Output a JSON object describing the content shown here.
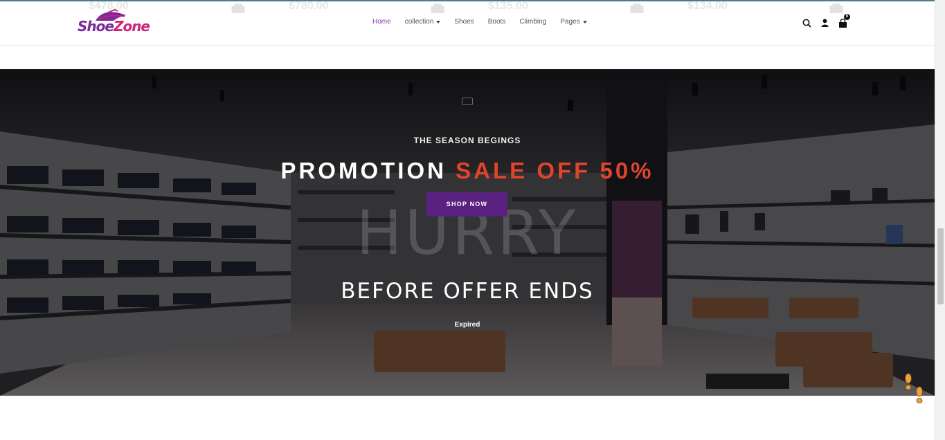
{
  "peek_prices": [
    "$478.00",
    "$780.00",
    "$135.00",
    "$134.00"
  ],
  "header": {
    "logo": {
      "shoe": "Shoe",
      "zone": "Zone"
    },
    "nav": [
      {
        "label": "Home",
        "active": true,
        "dropdown": false
      },
      {
        "label": "collection",
        "active": false,
        "dropdown": true
      },
      {
        "label": "Shoes",
        "active": false,
        "dropdown": false
      },
      {
        "label": "Boots",
        "active": false,
        "dropdown": false
      },
      {
        "label": "Climbing",
        "active": false,
        "dropdown": false
      },
      {
        "label": "Pages",
        "active": false,
        "dropdown": true
      }
    ],
    "icons": [
      "search-icon",
      "user-icon",
      "shopping-bag-icon"
    ],
    "cart_count": "0"
  },
  "hero": {
    "kicker": "THE SEASON BEGINGS",
    "promo_white": "PROMOTION",
    "promo_red": "SALE OFF 50%",
    "watermark": "HURRY",
    "button": "SHOP NOW",
    "offer": "BEFORE OFFER ENDS",
    "countdown": "Expired"
  },
  "colors": {
    "accent_purple": "#5a2180",
    "promo_red": "#e0442d",
    "nav_active": "#8a3aa6"
  }
}
